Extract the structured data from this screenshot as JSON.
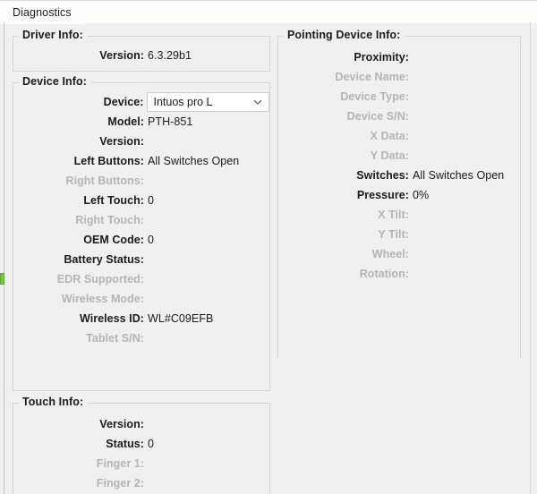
{
  "window": {
    "tab_label": "Diagnostics"
  },
  "driver_info": {
    "legend": "Driver Info:",
    "rows": [
      {
        "label": "Version:",
        "value": "6.3.29b1",
        "dim": false
      }
    ]
  },
  "device_info": {
    "legend": "Device Info:",
    "device_row": {
      "label": "Device:",
      "selected": "Intuos pro L",
      "chevron_icon": "chevron-down-icon"
    },
    "rows": [
      {
        "label": "Model:",
        "value": "PTH-851",
        "dim": false
      },
      {
        "label": "Version:",
        "value": "",
        "dim": false
      },
      {
        "label": "Left Buttons:",
        "value": "All Switches Open",
        "dim": false
      },
      {
        "label": "Right Buttons:",
        "value": "",
        "dim": true
      },
      {
        "label": "Left Touch:",
        "value": "0",
        "dim": false
      },
      {
        "label": "Right Touch:",
        "value": "",
        "dim": true
      },
      {
        "label": "OEM Code:",
        "value": "0",
        "dim": false
      },
      {
        "label": "Battery Status:",
        "value": "",
        "dim": false
      },
      {
        "label": "EDR Supported:",
        "value": "",
        "dim": true
      },
      {
        "label": "Wireless Mode:",
        "value": "",
        "dim": true
      },
      {
        "label": "Wireless ID:",
        "value": "WL#C09EFB",
        "dim": false
      },
      {
        "label": "Tablet S/N:",
        "value": "",
        "dim": true
      }
    ]
  },
  "touch_info": {
    "legend": "Touch Info:",
    "rows": [
      {
        "label": "Version:",
        "value": "",
        "dim": false
      },
      {
        "label": "Status:",
        "value": "0",
        "dim": false
      },
      {
        "label": "Finger 1:",
        "value": "",
        "dim": true
      },
      {
        "label": "Finger 2:",
        "value": "",
        "dim": true
      }
    ]
  },
  "pointing_device_info": {
    "legend": "Pointing Device Info:",
    "rows": [
      {
        "label": "Proximity:",
        "value": "",
        "dim": false
      },
      {
        "label": "Device Name:",
        "value": "",
        "dim": true
      },
      {
        "label": "Device Type:",
        "value": "",
        "dim": true
      },
      {
        "label": "Device S/N:",
        "value": "",
        "dim": true
      },
      {
        "label": "X Data:",
        "value": "",
        "dim": true
      },
      {
        "label": "Y Data:",
        "value": "",
        "dim": true
      },
      {
        "label": "Switches:",
        "value": "All Switches Open",
        "dim": false
      },
      {
        "label": "Pressure:",
        "value": "0%",
        "dim": false
      },
      {
        "label": "X Tilt:",
        "value": "",
        "dim": true
      },
      {
        "label": "Y Tilt:",
        "value": "",
        "dim": true
      },
      {
        "label": "Wheel:",
        "value": "",
        "dim": true
      },
      {
        "label": "Rotation:",
        "value": "",
        "dim": true
      }
    ]
  },
  "colors": {
    "background": "#f0f0f0",
    "tab_background": "#fdfdfb",
    "group_border": "#d4d4d4",
    "text": "#1b1b1b",
    "disabled_text": "#b4b4b4",
    "edge_marker": "#7ac943"
  }
}
